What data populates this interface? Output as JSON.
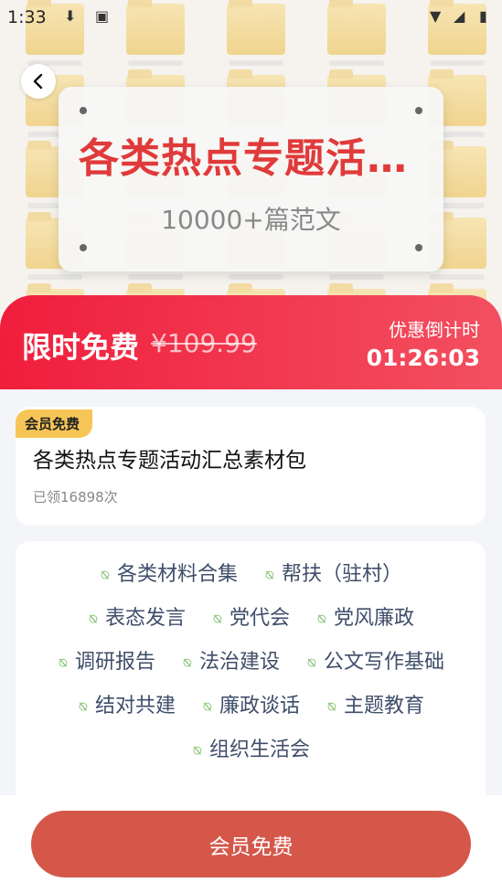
{
  "status_bar": {
    "time": "1:33"
  },
  "hero_card": {
    "title": "各类热点专题活…",
    "subtitle": "10000+篇范文"
  },
  "promo": {
    "label": "限时免费",
    "original_price": "¥109.99",
    "countdown_label": "优惠倒计时",
    "countdown": "01:26:03"
  },
  "info": {
    "badge": "会员免费",
    "title": "各类热点专题活动汇总素材包",
    "count_text": "已领16898次"
  },
  "tags": [
    [
      "各类材料合集",
      "帮扶（驻村）"
    ],
    [
      "表态发言",
      "党代会",
      "党风廉政"
    ],
    [
      "调研报告",
      "法治建设",
      "公文写作基础"
    ],
    [
      "结对共建",
      "廉政谈话",
      "主题教育"
    ],
    [
      "组织生活会"
    ]
  ],
  "cta": {
    "label": "会员免费"
  },
  "colors": {
    "accent_red": "#e03a3a",
    "promo_gradient_start": "#f01e3c",
    "cta": "#d5574a",
    "badge": "#f7c556",
    "clip_icon": "#7cbf68"
  }
}
